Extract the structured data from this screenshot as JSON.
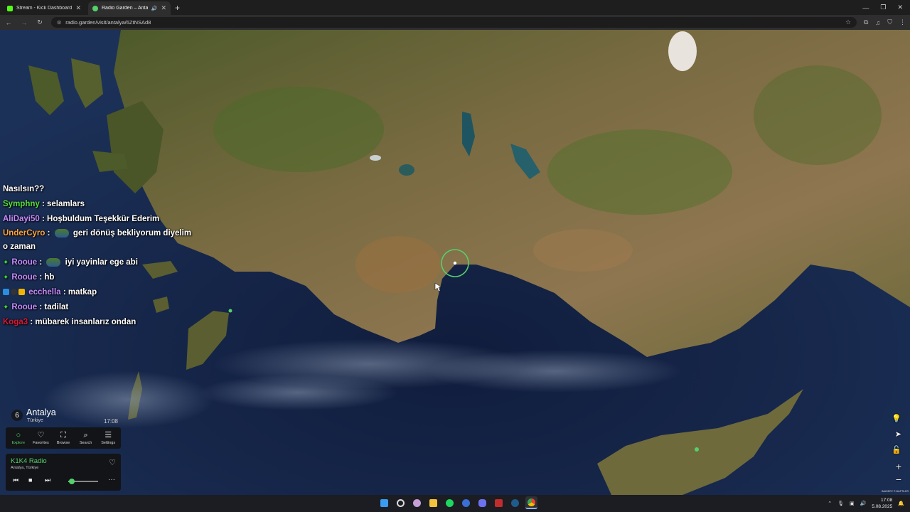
{
  "tabs": [
    {
      "title": "Stream - Kick Dashboard",
      "favicon_color": "#53fc18",
      "close": "✕"
    },
    {
      "title": "Radio Garden – Antalya",
      "favicon_color": "#55d06a",
      "close": "✕",
      "sound": "🔊"
    }
  ],
  "new_tab": "+",
  "window_controls": {
    "minimize": "—",
    "maximize": "❐",
    "close": "✕"
  },
  "url": "radio.garden/visit/antalya/6ZtNSAd8",
  "chat": [
    {
      "user": "",
      "user_color": "#ffffff",
      "text": "Nasılsın??"
    },
    {
      "user": "Symphny",
      "user_color": "#58e33a",
      "text": ": selamlars"
    },
    {
      "user": "AliDayi50",
      "user_color": "#c58bff",
      "text": ": Hoşbuldum Teşekkür Ederim"
    },
    {
      "user": "UnderCyro",
      "user_color": "#ffa43b",
      "text": ":",
      "text2": "geri dönüş bekliyorum diyelim o zaman"
    },
    {
      "user": "Rooue",
      "user_color": "#c58bff",
      "text": ":",
      "text2": "iyi yayinlar ege abi"
    },
    {
      "user": "Rooue",
      "user_color": "#c58bff",
      "text": ": hb"
    },
    {
      "user": "ecchella",
      "user_color": "#c58bff",
      "text": ": matkap"
    },
    {
      "user": "Rooue",
      "user_color": "#c58bff",
      "text": ": tadilat"
    },
    {
      "user": "Koga3",
      "user_color": "#d81b35",
      "text": ": mübarek insanlarız ondan"
    }
  ],
  "place": {
    "count": "6",
    "city": "Antalya",
    "country": "Türkiye",
    "time": "17:08"
  },
  "nav": [
    {
      "icon": "compass-icon",
      "glyph": "○",
      "label": "Explore",
      "selected": true
    },
    {
      "icon": "heart-icon",
      "glyph": "♡",
      "label": "Favorites",
      "selected": false
    },
    {
      "icon": "map-icon",
      "glyph": "⛶",
      "label": "Browse",
      "selected": false
    },
    {
      "icon": "search-icon",
      "glyph": "⌕",
      "label": "Search",
      "selected": false
    },
    {
      "icon": "menu-icon",
      "glyph": "☰",
      "label": "Settings",
      "selected": false
    }
  ],
  "player": {
    "station": "K1K4 Radio",
    "location": "Antalya, Türkiye",
    "volume_fraction": 0.12
  },
  "map_controls": [
    "💡",
    "➤",
    "🔓",
    "+",
    "−"
  ],
  "attribution": "IMAGERY © MAPTILER",
  "taskbar": {
    "time": "17:08",
    "date": "5.08.2025"
  },
  "colors": {
    "accent_green": "#55d06a",
    "sea": "#0d1e3e",
    "land": "#6b6a3c"
  }
}
